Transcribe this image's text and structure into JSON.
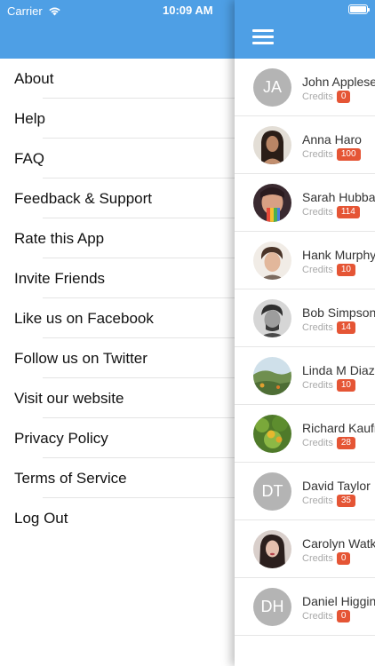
{
  "status_bar": {
    "carrier": "Carrier",
    "time": "10:09 AM"
  },
  "menu": {
    "items": [
      {
        "label": "About"
      },
      {
        "label": "Help"
      },
      {
        "label": "FAQ"
      },
      {
        "label": "Feedback & Support"
      },
      {
        "label": "Rate this App"
      },
      {
        "label": "Invite Friends"
      },
      {
        "label": "Like us on Facebook"
      },
      {
        "label": "Follow us on Twitter"
      },
      {
        "label": "Visit our website"
      },
      {
        "label": "Privacy Policy"
      },
      {
        "label": "Terms of Service"
      },
      {
        "label": "Log Out"
      }
    ]
  },
  "contacts": {
    "credits_label": "Credits",
    "items": [
      {
        "name": "John Appleseed",
        "initials": "JA",
        "credits": "0"
      },
      {
        "name": "Anna Haro",
        "initials": "",
        "credits": "100"
      },
      {
        "name": "Sarah Hubbard",
        "initials": "",
        "credits": "114"
      },
      {
        "name": "Hank Murphy",
        "initials": "",
        "credits": "10"
      },
      {
        "name": "Bob Simpson",
        "initials": "",
        "credits": "14"
      },
      {
        "name": "Linda M Diaz",
        "initials": "",
        "credits": "10"
      },
      {
        "name": "Richard Kaufman",
        "initials": "",
        "credits": "28"
      },
      {
        "name": "David Taylor",
        "initials": "DT",
        "credits": "35"
      },
      {
        "name": "Carolyn Watkins",
        "initials": "",
        "credits": "0"
      },
      {
        "name": "Daniel Higgins",
        "initials": "DH",
        "credits": "0"
      }
    ]
  },
  "colors": {
    "header": "#4e9fe5",
    "badge": "#e55535",
    "initials_bg": "#b4b4b4"
  },
  "icons": {
    "menu": "hamburger-icon",
    "wifi": "wifi-icon",
    "battery": "battery-icon"
  }
}
